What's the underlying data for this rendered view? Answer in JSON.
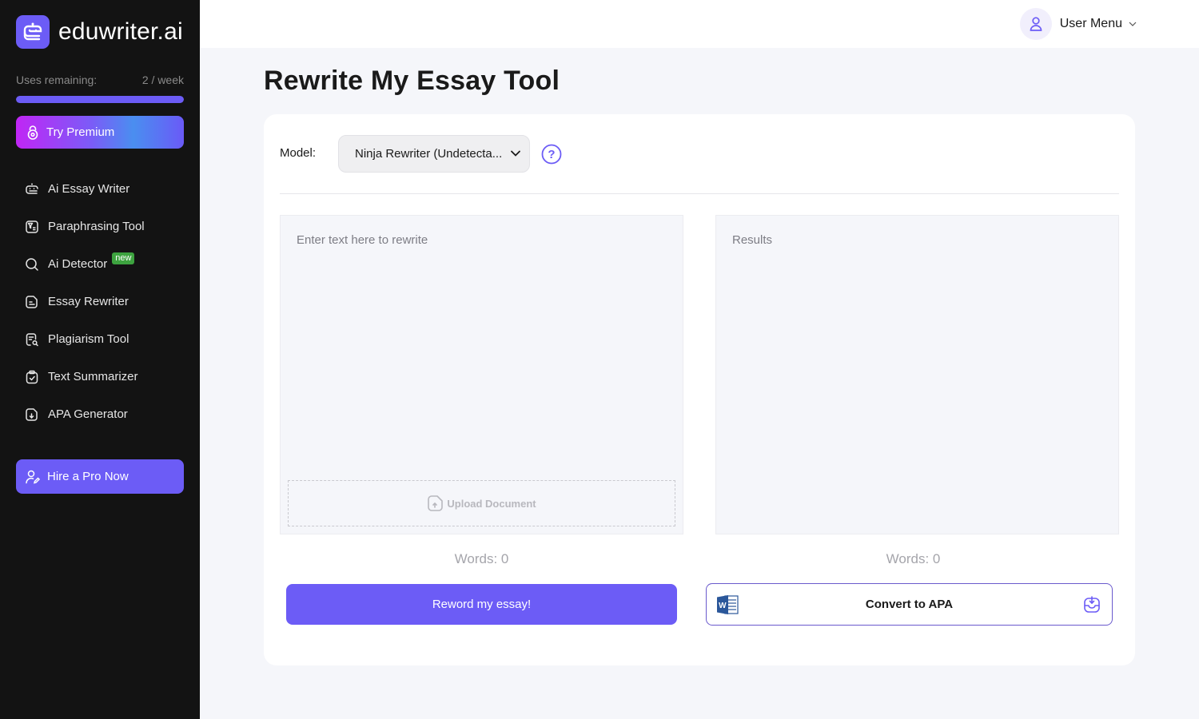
{
  "brand": {
    "name": "eduwriter.ai",
    "accent": "#6c5cf6"
  },
  "usage": {
    "label": "Uses remaining:",
    "value": "2 / week",
    "fill_fraction": 1.0
  },
  "sidebar": {
    "premium_label": "Try Premium",
    "items": [
      {
        "label": "Ai Essay Writer",
        "icon": "robot-icon"
      },
      {
        "label": "Paraphrasing Tool",
        "icon": "paraphrase-icon"
      },
      {
        "label": "Ai Detector",
        "icon": "search-icon",
        "badge": "new"
      },
      {
        "label": "Essay Rewriter",
        "icon": "document-icon"
      },
      {
        "label": "Plagiarism Tool",
        "icon": "document-search-icon"
      },
      {
        "label": "Text Summarizer",
        "icon": "clipboard-check-icon"
      },
      {
        "label": "APA Generator",
        "icon": "file-download-icon"
      }
    ],
    "hire_label": "Hire a Pro Now"
  },
  "header": {
    "user_menu_label": "User Menu"
  },
  "main": {
    "title": "Rewrite My Essay Tool",
    "model_label": "Model:",
    "model_value": "Ninja Rewriter (Undetecta...",
    "input_placeholder": "Enter text here to rewrite",
    "upload_label": "Upload Document",
    "results_placeholder": "Results",
    "input_words": "Words: 0",
    "output_words": "Words: 0",
    "reword_button": "Reword my essay!",
    "apa_button": "Convert to APA"
  }
}
